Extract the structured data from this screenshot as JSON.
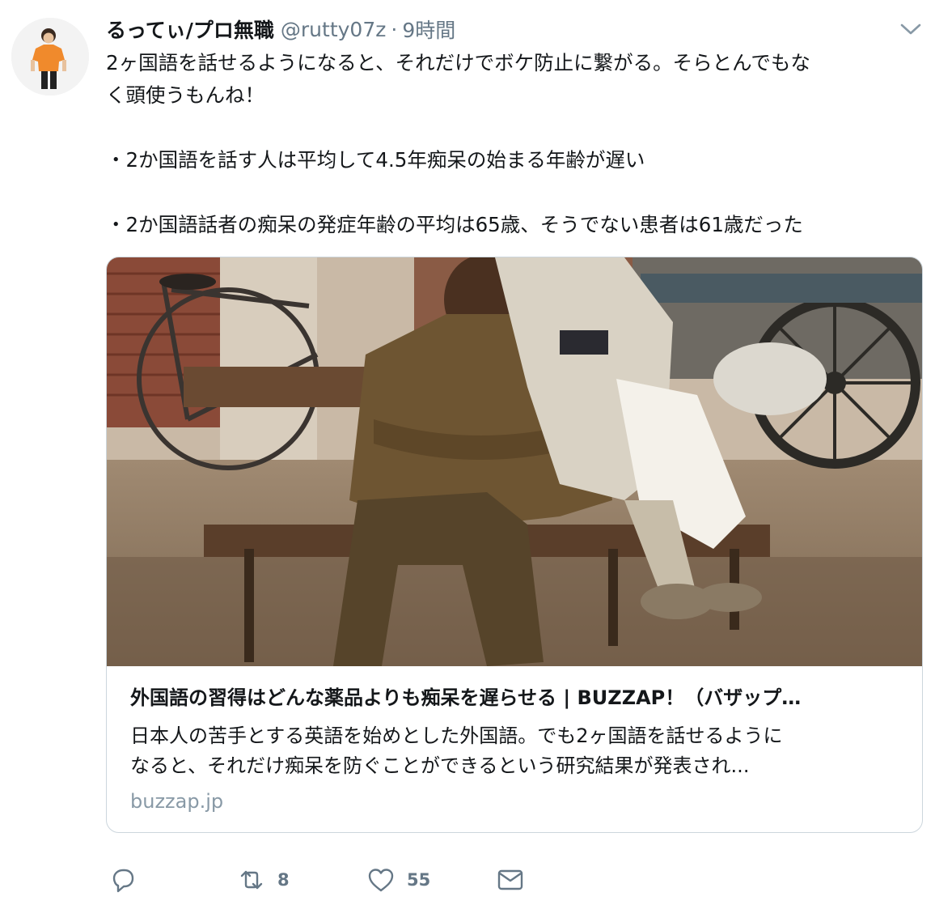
{
  "tweet": {
    "user": {
      "display_name": "るってぃ/プロ無職",
      "handle": "@rutty07z"
    },
    "separator": "·",
    "time": "9時間",
    "text_lines": [
      "2ヶ国語を話せるようになると、それだけでボケ防止に繋がる。そらとんでもな",
      "く頭使うもんね！",
      "",
      "・2か国語を話す人は平均して4.5年痴呆の始まる年齢が遅い",
      "",
      "・2か国語話者の痴呆の発症年齢の平均は65歳、そうでない患者は61歳だった"
    ],
    "card": {
      "title": "外国語の習得はどんな薬品よりも痴呆を遅らせる | BUZZAP！（バザップ…",
      "description_lines": [
        "日本人の苦手とする英語を始めとした外国語。でも2ヶ国語を話せるように",
        "なると、それだけ痴呆を防ぐことができるという研究結果が発表され..."
      ],
      "domain": "buzzap.jp"
    },
    "actions": {
      "reply": {
        "icon": "reply-icon",
        "count": ""
      },
      "retweet": {
        "icon": "retweet-icon",
        "count": "8"
      },
      "like": {
        "icon": "heart-icon",
        "count": "55"
      },
      "dm": {
        "icon": "envelope-icon",
        "count": ""
      }
    }
  },
  "colors": {
    "text": "#14171a",
    "secondary": "#657786",
    "border": "#ccd6dd",
    "domain": "#8899a6",
    "avatar_shirt": "#f08a2c"
  }
}
